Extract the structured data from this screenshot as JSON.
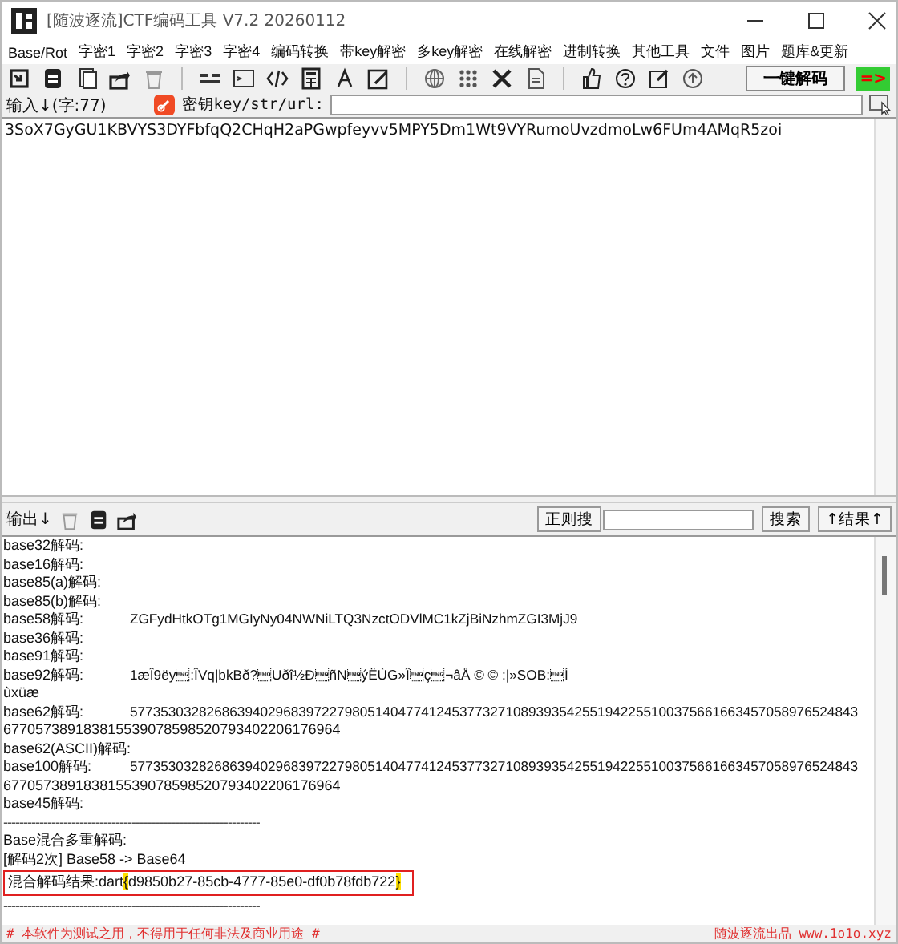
{
  "window": {
    "title": "[随波逐流]CTF编码工具 V7.2  20260112"
  },
  "menu": [
    "Base/Rot",
    "字密1",
    "字密2",
    "字密3",
    "字密4",
    "编码转换",
    "带key解密",
    "多key解密",
    "在线解密",
    "进制转换",
    "其他工具",
    "文件",
    "图片",
    "题库&更新"
  ],
  "decode_button": "一键解码",
  "arrow_tab": "=>",
  "input_bar": {
    "label": "输入↓(字:77)",
    "key_label": "密钥key/str/url:"
  },
  "input_text": "3SoX7GyGU1KBVYS3DYFbfqQ2CHqH2aPGwpfeyvv5MPY5Dm1Wt9VYRumoUvzdmoLw6FUm4AMqR5zoi",
  "output_bar": {
    "label": "输出↓",
    "regex_button": "正则搜",
    "search_button": "搜索",
    "result_button": "↑结果↑"
  },
  "output_lines": [
    {
      "kind": "entry",
      "label": "base32解码:"
    },
    {
      "kind": "entry",
      "label": "base16解码:"
    },
    {
      "kind": "entry",
      "label": "base85(a)解码:"
    },
    {
      "kind": "entry",
      "label": "base85(b)解码:"
    },
    {
      "kind": "entry",
      "label": "base58解码:",
      "value": "ZGFydHtkOTg1MGIyNy04NWNiLTQ3NzctODVlMC1kZjBiNzhmZGI3MjJ9"
    },
    {
      "kind": "entry",
      "label": "base36解码:"
    },
    {
      "kind": "entry",
      "label": "base91解码:"
    },
    {
      "kind": "entry",
      "label": "base92解码:",
      "value": "1æÎ9ëy\u0005:ÎVq|bkBð?\u0005Uðî½Ð\u0005ñN\u0005ýËÙG»Î\u0005ç\u0005¬âÅ © © :|»SOB:\u0005Í"
    },
    {
      "kind": "text",
      "label": "ùxüæ"
    },
    {
      "kind": "entry",
      "label": "base62解码:",
      "value": "57735303282686394029683972279805140477412453773271089393542551942255100375661663457058976524843"
    },
    {
      "kind": "text",
      "label": "677057389183815539078598520793402206176964"
    },
    {
      "kind": "entry",
      "label": "base62(ASCII)解码:"
    },
    {
      "kind": "entry",
      "label": "base100解码:",
      "value": "57735303282686394029683972279805140477412453773271089393542551942255100375661663457058976524843"
    },
    {
      "kind": "text",
      "label": "677057389183815539078598520793402206176964"
    },
    {
      "kind": "entry",
      "label": "base45解码:"
    },
    {
      "kind": "divider",
      "label": "----------------------------------------------------------------"
    },
    {
      "kind": "text",
      "label": "Base混合多重解码:"
    },
    {
      "kind": "text",
      "label": "[解码2次] Base58 -> Base64"
    },
    {
      "kind": "result",
      "label": "混合解码结果:",
      "value": "dart",
      "segments": [
        {
          "text": "{",
          "highlighted": true
        },
        {
          "text": "d9850b27-85cb-4777-85e0-df0b78fdb722",
          "highlighted": false
        },
        {
          "text": "}",
          "highlighted": true
        }
      ]
    },
    {
      "kind": "divider",
      "label": "----------------------------------------------------------------"
    }
  ],
  "status": {
    "left": "# 本软件为测试之用，不得用于任何非法及商业用途 #",
    "right": "随波逐流出品 www.1o1o.xyz"
  }
}
